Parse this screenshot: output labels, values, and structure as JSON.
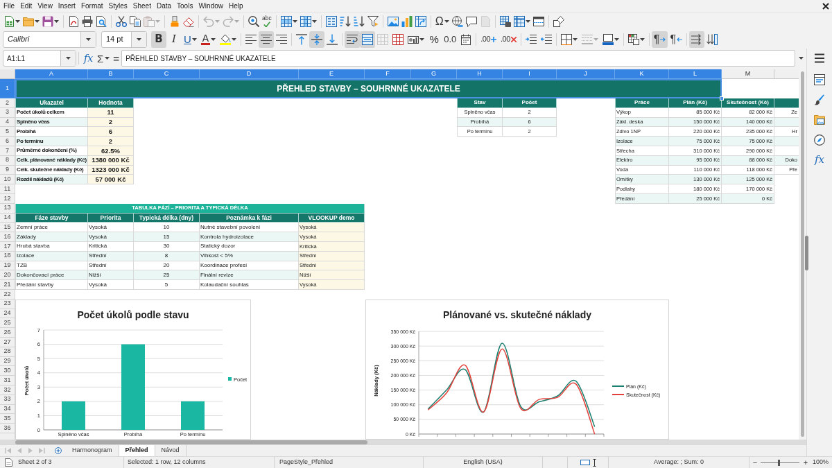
{
  "menu_bar": [
    "File",
    "Edit",
    "View",
    "Insert",
    "Format",
    "Styles",
    "Sheet",
    "Data",
    "Tools",
    "Window",
    "Help"
  ],
  "standard_toolbar": {
    "paste": {
      "disabled": true
    },
    "undo": {
      "disabled": true
    },
    "redo": {
      "disabled": true
    },
    "spelling": {
      "glyph": "abc"
    },
    "special_character": {
      "glyph": "Ω"
    },
    "headers_footers": {
      "disabled": true
    }
  },
  "formatting_toolbar": {
    "font_name": "Calibri",
    "font_size": "14 pt",
    "bold": {
      "glyph": "B",
      "pressed": true
    },
    "italic": {
      "glyph": "I",
      "pressed": false
    },
    "underline": {
      "glyph": "U",
      "pressed": false
    },
    "font_color": {
      "glyph": "A"
    },
    "align_left": {
      "pressed": false
    },
    "align_center": {
      "pressed": true
    },
    "align_right": {
      "pressed": false
    },
    "align_top": {
      "pressed": false
    },
    "align_middle": {
      "pressed": true
    },
    "align_bottom": {
      "pressed": false
    },
    "wrap_text": {
      "pressed": true
    },
    "merge_center": {
      "pressed": true
    },
    "merge_cells": {
      "disabled": true
    },
    "percent": {
      "glyph": "%"
    },
    "number": {
      "glyph": "0.0"
    },
    "add_decimal": {
      "glyph": ".00"
    },
    "delete_decimal": {
      "glyph": ".00"
    },
    "border_style": {
      "disabled": true
    },
    "left_to_right": {
      "glyph": "¶",
      "pressed": true
    },
    "right_to_left": {
      "glyph": "¶",
      "pressed": false
    },
    "text_flow": {
      "pressed": true
    }
  },
  "formula_bar": {
    "name_box": "A1:L1",
    "function_wizard": "fx",
    "sum": "Σ",
    "equals": "=",
    "content": "PŘEHLED STAVBY – SOUHRNNÉ UKAZATELE"
  },
  "columns": [
    {
      "label": "A",
      "selected": true
    },
    {
      "label": "B",
      "selected": true
    },
    {
      "label": "C",
      "selected": true
    },
    {
      "label": "D",
      "selected": true
    },
    {
      "label": "E",
      "selected": true
    },
    {
      "label": "F",
      "selected": true
    },
    {
      "label": "G",
      "selected": true
    },
    {
      "label": "H",
      "selected": true
    },
    {
      "label": "I",
      "selected": true
    },
    {
      "label": "J",
      "selected": true
    },
    {
      "label": "K",
      "selected": true
    },
    {
      "label": "L",
      "selected": true
    },
    {
      "label": "M",
      "selected": false
    }
  ],
  "rows": [
    {
      "label": "1",
      "selected": true
    },
    {
      "label": "2",
      "selected": false
    },
    {
      "label": "3",
      "selected": false
    },
    {
      "label": "4",
      "selected": false
    },
    {
      "label": "5",
      "selected": false
    },
    {
      "label": "6",
      "selected": false
    },
    {
      "label": "7",
      "selected": false
    },
    {
      "label": "8",
      "selected": false
    },
    {
      "label": "9",
      "selected": false
    },
    {
      "label": "10",
      "selected": false
    },
    {
      "label": "11",
      "selected": false
    },
    {
      "label": "12",
      "selected": false
    },
    {
      "label": "13",
      "selected": false
    },
    {
      "label": "14",
      "selected": false
    },
    {
      "label": "15",
      "selected": false
    },
    {
      "label": "16",
      "selected": false
    },
    {
      "label": "17",
      "selected": false
    },
    {
      "label": "18",
      "selected": false
    },
    {
      "label": "19",
      "selected": false
    },
    {
      "label": "20",
      "selected": false
    },
    {
      "label": "21",
      "selected": false
    },
    {
      "label": "22",
      "selected": false
    },
    {
      "label": "23",
      "selected": false
    },
    {
      "label": "24",
      "selected": false
    },
    {
      "label": "25",
      "selected": false
    },
    {
      "label": "26",
      "selected": false
    },
    {
      "label": "27",
      "selected": false
    },
    {
      "label": "28",
      "selected": false
    },
    {
      "label": "29",
      "selected": false
    },
    {
      "label": "30",
      "selected": false
    },
    {
      "label": "31",
      "selected": false
    },
    {
      "label": "32",
      "selected": false
    },
    {
      "label": "33",
      "selected": false
    },
    {
      "label": "34",
      "selected": false
    },
    {
      "label": "35",
      "selected": false
    },
    {
      "label": "36",
      "selected": false
    }
  ],
  "title_banner": {
    "text": "PŘEHLED STAVBY – SOUHRNNÉ UKAZATELE",
    "selected": true
  },
  "summary_table": {
    "columns": [
      "Ukazatel",
      "Hodnota"
    ],
    "rows": [
      [
        "Počet úkolů celkem",
        "11"
      ],
      [
        "Splněno včas",
        "2"
      ],
      [
        "Probíhá",
        "6"
      ],
      [
        "Po termínu",
        "2"
      ],
      [
        "Průměrné dokončení (%)",
        "62.5%"
      ],
      [
        "Celk. plánované náklady (Kč)",
        "1380 000 Kč"
      ],
      [
        "Celk. skutečné náklady (Kč)",
        "1323 000 Kč"
      ],
      [
        "Rozdíl nákladů (Kč)",
        "57 000 Kč"
      ]
    ]
  },
  "status_table": {
    "columns": [
      "Stav",
      "Počet"
    ],
    "rows": [
      [
        "Splněno včas",
        "2"
      ],
      [
        "Probíhá",
        "6"
      ],
      [
        "Po termínu",
        "2"
      ]
    ]
  },
  "cost_table": {
    "columns": [
      "Práce",
      "Plán (Kč)",
      "Skutečnost (Kč)"
    ],
    "rows": [
      [
        "Výkop",
        "85 000 Kč",
        "82 000 Kč"
      ],
      [
        "Zákl. deska",
        "150 000 Kč",
        "140 000 Kč"
      ],
      [
        "Zdivo 1NP",
        "220 000 Kč",
        "235 000 Kč"
      ],
      [
        "Izolace",
        "75 000 Kč",
        "75 000 Kč"
      ],
      [
        "Střecha",
        "310 000 Kč",
        "290 000 Kč"
      ],
      [
        "Elektro",
        "95 000 Kč",
        "88 000 Kč"
      ],
      [
        "Voda",
        "110 000 Kč",
        "118 000 Kč"
      ],
      [
        "Omítky",
        "130 000 Kč",
        "125 000 Kč"
      ],
      [
        "Podlahy",
        "180 000 Kč",
        "170 000 Kč"
      ],
      [
        "Předání",
        "25 000 Kč",
        "0 Kč"
      ]
    ]
  },
  "clipped_column": {
    "cells": [
      {
        "text": "Ze"
      },
      {},
      {
        "text": "Hr"
      },
      {},
      {},
      {
        "text": "Doko"
      },
      {
        "text": "Pře"
      }
    ]
  },
  "phase_table": {
    "title": "TABULKA FÁZÍ – PRIORITA A TYPICKÁ DÉLKA",
    "columns": [
      "Fáze stavby",
      "Priorita",
      "Typická délka (dny)",
      "Poznámka k fázi",
      "VLOOKUP demo"
    ],
    "rows": [
      [
        "Zemní práce",
        "Vysoká",
        "10",
        "Nutné stavební povolení",
        "Vysoká"
      ],
      [
        "Základy",
        "Vysoká",
        "15",
        "Kontrola hydroizolace",
        "Vysoká"
      ],
      [
        "Hrubá stavba",
        "Kritická",
        "30",
        "Statický dozor",
        "Kritická"
      ],
      [
        "Izolace",
        "Střední",
        "8",
        "Vlhkost < 5%",
        "Střední"
      ],
      [
        "TZB",
        "Střední",
        "20",
        "Koordinace profesí",
        "Střední"
      ],
      [
        "Dokončovací práce",
        "Nižší",
        "25",
        "Finální revize",
        "Nižší"
      ],
      [
        "Předání stavby",
        "Vysoká",
        "5",
        "Kolaudační souhlas",
        "Vysoká"
      ]
    ]
  },
  "charts": [
    {
      "chart_data": {
        "type": "bar",
        "title": "Počet úkolů podle stavu",
        "ylabel": "Počet úkolů",
        "categories": [
          "Splněno včas",
          "Probíhá",
          "Po termínu"
        ],
        "series": [
          {
            "name": "Počet",
            "color": "#1ab7a3",
            "values": [
              2,
              6,
              2
            ]
          }
        ],
        "ylim": [
          0,
          7
        ],
        "yticks": [
          {
            "value": 0,
            "label": "0"
          },
          {
            "value": 1,
            "label": "1"
          },
          {
            "value": 2,
            "label": "2"
          },
          {
            "value": 3,
            "label": "3"
          },
          {
            "value": 4,
            "label": "4"
          },
          {
            "value": 5,
            "label": "5"
          },
          {
            "value": 6,
            "label": "6"
          },
          {
            "value": 7,
            "label": "7"
          }
        ],
        "grid": true,
        "legend": "right"
      }
    },
    {
      "chart_data": {
        "type": "line",
        "title": "Plánované vs. skutečné náklady",
        "ylabel": "Náklady (Kč)",
        "series": [
          {
            "name": "Plán (Kč)",
            "color": "#1b7f70",
            "values": [
              85000,
              150000,
              220000,
              75000,
              310000,
              95000,
              110000,
              130000,
              180000,
              25000
            ]
          },
          {
            "name": "Skutečnost (Kč)",
            "color": "#e2403a",
            "values": [
              82000,
              140000,
              235000,
              75000,
              290000,
              88000,
              118000,
              125000,
              170000,
              0
            ]
          }
        ],
        "ylim": [
          0,
          350000
        ],
        "yticks": [
          {
            "value": 0,
            "label": "0 Kč"
          },
          {
            "value": 50000,
            "label": "50 000 Kč"
          },
          {
            "value": 100000,
            "label": "100 000 Kč"
          },
          {
            "value": 150000,
            "label": "150 000 Kč"
          },
          {
            "value": 200000,
            "label": "200 000 Kč"
          },
          {
            "value": 250000,
            "label": "250 000 Kč"
          },
          {
            "value": 300000,
            "label": "300 000 Kč"
          },
          {
            "value": 350000,
            "label": "350 000 Kč"
          }
        ],
        "grid": true,
        "legend": "right"
      }
    }
  ],
  "sheet_navigation": {
    "disabled": true
  },
  "sheet_tabs": [
    {
      "label": "Harmonogram",
      "selected": false
    },
    {
      "label": "Přehled",
      "selected": true
    },
    {
      "label": "Návod",
      "selected": false
    }
  ],
  "sidebar": {
    "functions": "fx"
  },
  "status_bar": {
    "sheet": "Sheet 2 of 3",
    "selection": "Selected: 1 row, 12 columns",
    "page_style": "PageStyle_Přehled",
    "language": "English (USA)",
    "summary": "Average: ; Sum: 0",
    "zoom_out": "−",
    "zoom_slider": {
      "level": 0.44
    },
    "zoom_in": "+",
    "zoom": "100%"
  }
}
